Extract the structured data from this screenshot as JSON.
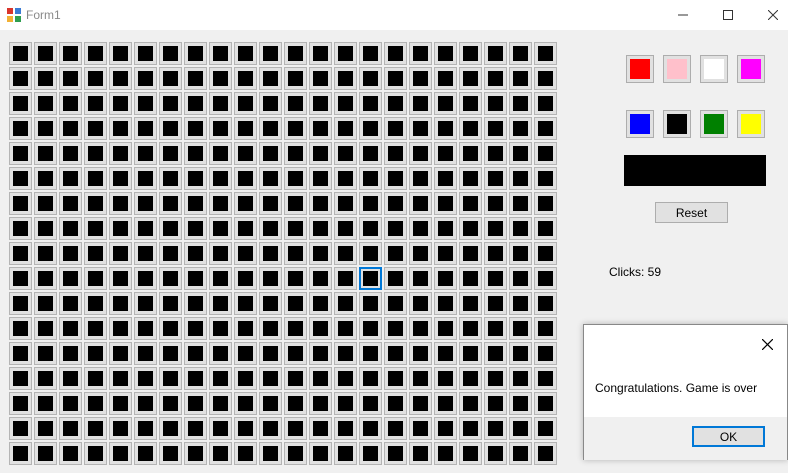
{
  "window": {
    "title": "Form1",
    "icon": "form-app-icon",
    "controls": [
      "minimize-icon",
      "maximize-icon",
      "close-icon"
    ]
  },
  "grid": {
    "rows": 17,
    "cols": 22,
    "cell_color": "#000000",
    "selected_cell": {
      "row": 9,
      "col": 14
    }
  },
  "palette": [
    {
      "name": "red",
      "color": "#ff0000"
    },
    {
      "name": "pink",
      "color": "#ffc0cb"
    },
    {
      "name": "white",
      "color": "#ffffff"
    },
    {
      "name": "magenta",
      "color": "#ff00ff"
    },
    {
      "name": "blue",
      "color": "#0000ff"
    },
    {
      "name": "black",
      "color": "#000000"
    },
    {
      "name": "green",
      "color": "#008000"
    },
    {
      "name": "yellow",
      "color": "#ffff00"
    }
  ],
  "current_color": "#000000",
  "reset_label": "Reset",
  "clicks_text": "Clicks: 59",
  "dialog": {
    "message": "Congratulations. Game is over",
    "ok_label": "OK"
  },
  "accent_color": "#0078d7"
}
